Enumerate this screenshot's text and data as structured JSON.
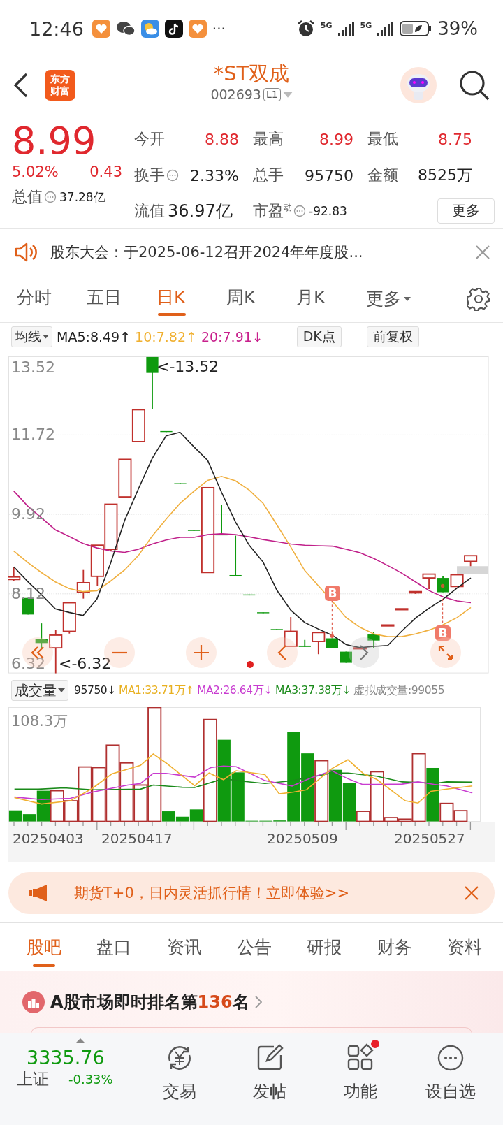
{
  "status_bar": {
    "time": "12:46",
    "more": "···",
    "networks": [
      "5G",
      "5G"
    ],
    "battery": "39%"
  },
  "header": {
    "logo": [
      "东方",
      "财富"
    ],
    "title": "*ST双成",
    "code": "002693",
    "level_badge": "L1"
  },
  "quote": {
    "price": "8.99",
    "change_pct": "5.02%",
    "change": "0.43",
    "total_value": {
      "label": "总值",
      "value": "37.28亿",
      "info": true
    },
    "stats": [
      [
        {
          "kind": "pair",
          "label": "今开",
          "value": "8.88",
          "info": false,
          "color": "#e0282e"
        },
        {
          "kind": "pair",
          "label": "最高",
          "value": "8.99",
          "info": false,
          "color": "#e0282e"
        },
        {
          "kind": "pair",
          "label": "最低",
          "value": "8.75",
          "info": false,
          "color": "#e0282e"
        }
      ],
      [
        {
          "kind": "pair",
          "label": "换手",
          "value": "2.33%",
          "info": true,
          "color": "#222222"
        },
        {
          "kind": "pair",
          "label": "总手",
          "value": "95750",
          "info": false,
          "color": "#222222"
        },
        {
          "kind": "pair",
          "label": "金额",
          "value": "8525万",
          "info": false,
          "color": "#222222"
        }
      ],
      [
        {
          "kind": "inline",
          "label": "流值",
          "value": "36.97亿",
          "info": false,
          "color": "#222222"
        },
        {
          "kind": "compact",
          "label": "市盈",
          "sup": "动",
          "value": "-92.83",
          "info": true,
          "color": "#222222"
        }
      ]
    ],
    "more_button": "更多"
  },
  "notice": {
    "text": "股东大会：于2025-06-12召开2024年年度股..."
  },
  "chart_tabs": [
    {
      "label": "分时",
      "selected": false,
      "kind": "tab"
    },
    {
      "label": "五日",
      "selected": false,
      "kind": "tab"
    },
    {
      "label": "日K",
      "selected": true,
      "kind": "tab"
    },
    {
      "label": "周K",
      "selected": false,
      "kind": "tab"
    },
    {
      "label": "月K",
      "selected": false,
      "kind": "tab"
    },
    {
      "label": "更多",
      "selected": false,
      "kind": "menu"
    }
  ],
  "ma_bar": {
    "selector": "均线",
    "values": [
      {
        "text": "MA5:8.49↑",
        "color": "#222222"
      },
      {
        "text": "10:7.82↑",
        "color": "#f0b030"
      },
      {
        "text": "20:7.91↓",
        "color": "#c8208c"
      }
    ],
    "buttons": [
      "DK点",
      "前复权"
    ]
  },
  "kline": {
    "high_label": "<-13.52",
    "low_label": "<-6.32",
    "markers": [
      "B",
      "B"
    ],
    "chart_data": {
      "type": "line",
      "grid": true,
      "ylim": [
        6.32,
        13.52
      ],
      "yticks": [
        13.52,
        11.72,
        9.92,
        8.12,
        6.32
      ],
      "series": [
        {
          "color": "#222222",
          "values": [
            8.73,
            8.4,
            8.1,
            7.78,
            7.7,
            7.63,
            8.0,
            8.82,
            9.78,
            10.5,
            11.19,
            11.7,
            11.78,
            11.45,
            11.14,
            10.42,
            9.75,
            9.22,
            8.84,
            8.2,
            7.75,
            7.47,
            7.32,
            7.18,
            6.97,
            6.9,
            6.93,
            6.95,
            7.27,
            7.57,
            7.8,
            8.0,
            8.25,
            8.48
          ]
        },
        {
          "color": "#f0b040",
          "values": [
            9.09,
            8.83,
            8.6,
            8.39,
            8.24,
            8.17,
            8.19,
            8.41,
            8.66,
            8.99,
            9.43,
            9.81,
            10.17,
            10.44,
            10.69,
            10.78,
            10.68,
            10.47,
            10.17,
            9.68,
            9.18,
            8.65,
            8.3,
            7.95,
            7.58,
            7.36,
            7.21,
            7.15,
            7.15,
            7.21,
            7.3,
            7.42,
            7.58,
            7.81
          ]
        },
        {
          "color": "#c0208a",
          "values": [
            10.45,
            10.11,
            9.84,
            9.57,
            9.42,
            9.26,
            9.16,
            9.09,
            9.06,
            9.13,
            9.25,
            9.34,
            9.4,
            9.4,
            9.46,
            9.48,
            9.46,
            9.41,
            9.35,
            9.3,
            9.25,
            9.22,
            9.21,
            9.2,
            9.13,
            9.05,
            8.92,
            8.76,
            8.59,
            8.39,
            8.19,
            8.05,
            7.96,
            7.92
          ]
        }
      ]
    }
  },
  "volume": {
    "selector": "成交量",
    "values": [
      {
        "text": "95750↓",
        "color": "#222222"
      },
      {
        "text": "MA1:33.71万↑",
        "color": "#e8b020"
      },
      {
        "text": "MA2:26.64万↓",
        "color": "#c83cd0"
      },
      {
        "text": "MA3:37.38万↓",
        "color": "#1a8a1a"
      },
      {
        "text": "虚拟成交量:99055",
        "color": "#888888"
      }
    ],
    "max_label": "108.3万",
    "dates": [
      "20250403",
      "20250417",
      "20250509",
      "20250527"
    ]
  },
  "banner": {
    "text": "期货T+0，日内灵活抓行情！立即体验>>"
  },
  "section_tabs": [
    {
      "label": "股吧",
      "selected": true
    },
    {
      "label": "盘口",
      "selected": false
    },
    {
      "label": "资讯",
      "selected": false
    },
    {
      "label": "公告",
      "selected": false
    },
    {
      "label": "研报",
      "selected": false
    },
    {
      "label": "财务",
      "selected": false
    },
    {
      "label": "资料",
      "selected": false
    }
  ],
  "rank": {
    "prefix": "A股市场即时排名第",
    "number": "136",
    "suffix": "名"
  },
  "bottom_nav": {
    "index": {
      "value": "3335.76",
      "name": "上证",
      "change": "-0.33%"
    },
    "items": [
      {
        "label": "交易",
        "badge": false
      },
      {
        "label": "发帖",
        "badge": false
      },
      {
        "label": "功能",
        "badge": true
      },
      {
        "label": "设自选",
        "badge": false
      }
    ]
  }
}
